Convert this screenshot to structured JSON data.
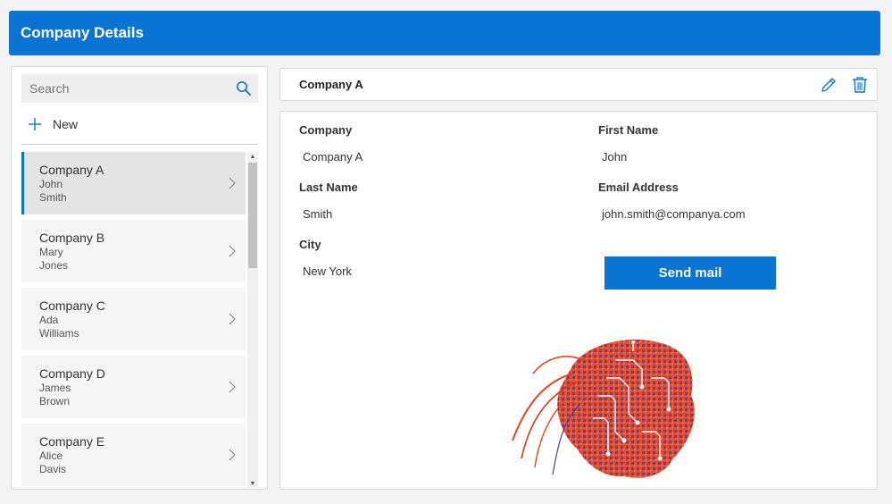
{
  "header": {
    "title": "Company Details"
  },
  "search": {
    "placeholder": "Search"
  },
  "new_button": {
    "label": "New"
  },
  "list": [
    {
      "company": "Company A",
      "first": "John",
      "last": "Smith"
    },
    {
      "company": "Company B",
      "first": "Mary",
      "last": "Jones"
    },
    {
      "company": "Company C",
      "first": "Ada",
      "last": "Williams"
    },
    {
      "company": "Company D",
      "first": "James",
      "last": "Brown"
    },
    {
      "company": "Company E",
      "first": "Alice",
      "last": "Davis"
    }
  ],
  "detail": {
    "title": "Company A",
    "company_label": "Company",
    "company_value": "Company A",
    "first_name_label": "First Name",
    "first_name_value": "John",
    "last_name_label": "Last Name",
    "last_name_value": "Smith",
    "email_label": "Email Address",
    "email_value": "john.smith@companya.com",
    "city_label": "City",
    "city_value": "New York",
    "send_label": "Send mail"
  },
  "icons": {
    "search": "search-icon",
    "add": "plus-icon",
    "chevron": "chevron-right-icon",
    "edit": "pencil-icon",
    "delete": "trash-icon"
  },
  "colors": {
    "accent": "#0a74d4",
    "illustration_primary": "#e8431f",
    "illustration_secondary": "#3d3fb0"
  }
}
